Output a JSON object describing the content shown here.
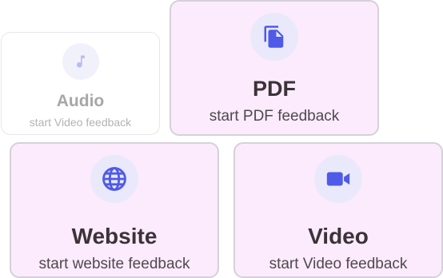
{
  "colors": {
    "accent": "#4f5ae8",
    "card_active_bg": "#fcebfc",
    "card_border": "#d4d1d8",
    "icon_bg": "#e9e9fb",
    "title_text": "#3a3338",
    "faded_text": "#a8a6a8"
  },
  "cards": [
    {
      "id": "audio",
      "icon": "music-note-icon",
      "title": "Audio",
      "subtitle": "start Video feedback",
      "state": "faded"
    },
    {
      "id": "pdf",
      "icon": "file-copy-icon",
      "title": "PDF",
      "subtitle": "start PDF feedback",
      "state": "active"
    },
    {
      "id": "website",
      "icon": "globe-icon",
      "title": "Website",
      "subtitle": "start website feedback",
      "state": "active"
    },
    {
      "id": "video",
      "icon": "video-camera-icon",
      "title": "Video",
      "subtitle": "start Video feedback",
      "state": "active"
    }
  ]
}
